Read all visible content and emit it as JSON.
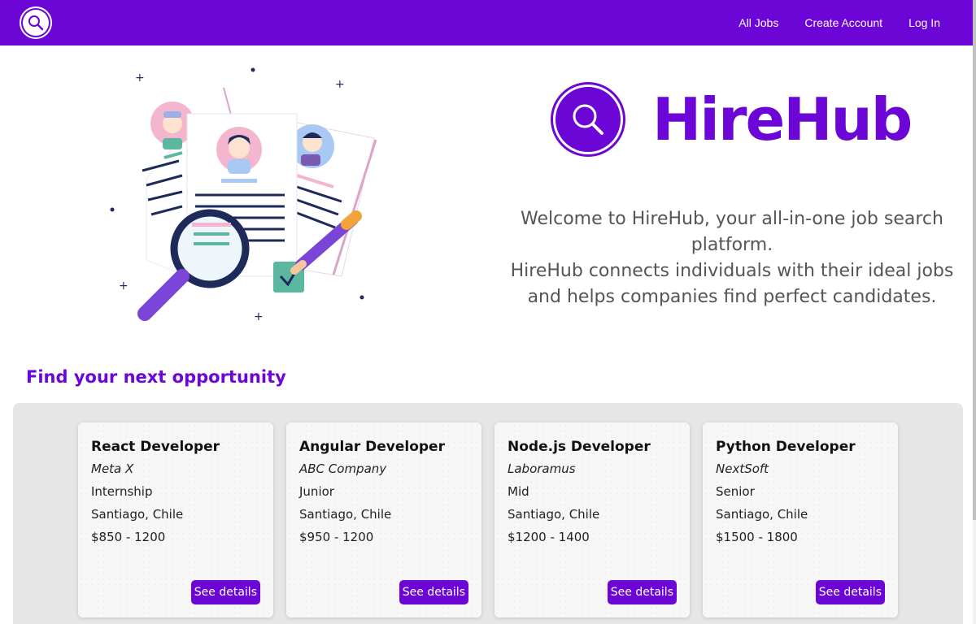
{
  "nav": {
    "logo_icon": "search-icon",
    "links": [
      "All Jobs",
      "Create Account",
      "Log In"
    ]
  },
  "brand": {
    "name": "HireHub",
    "icon": "search-icon",
    "color": "#6c06d6"
  },
  "hero": {
    "welcome_line1": "Welcome to HireHub, your all-in-one job search platform.",
    "welcome_line2": "HireHub connects individuals with their ideal jobs and helps companies find perfect candidates."
  },
  "section": {
    "title": "Find your next opportunity"
  },
  "jobs": [
    {
      "title": "React Developer",
      "company": "Meta X",
      "level": "Internship",
      "location": "Santiago, Chile",
      "salary": "$850 - 1200",
      "button": "See details"
    },
    {
      "title": "Angular Developer",
      "company": "ABC Company",
      "level": "Junior",
      "location": "Santiago, Chile",
      "salary": "$950 - 1200",
      "button": "See details"
    },
    {
      "title": "Node.js Developer",
      "company": "Laboramus",
      "level": "Mid",
      "location": "Santiago, Chile",
      "salary": "$1200 - 1400",
      "button": "See details"
    },
    {
      "title": "Python Developer",
      "company": "NextSoft",
      "level": "Senior",
      "location": "Santiago, Chile",
      "salary": "$1500 - 1800",
      "button": "See details"
    }
  ]
}
